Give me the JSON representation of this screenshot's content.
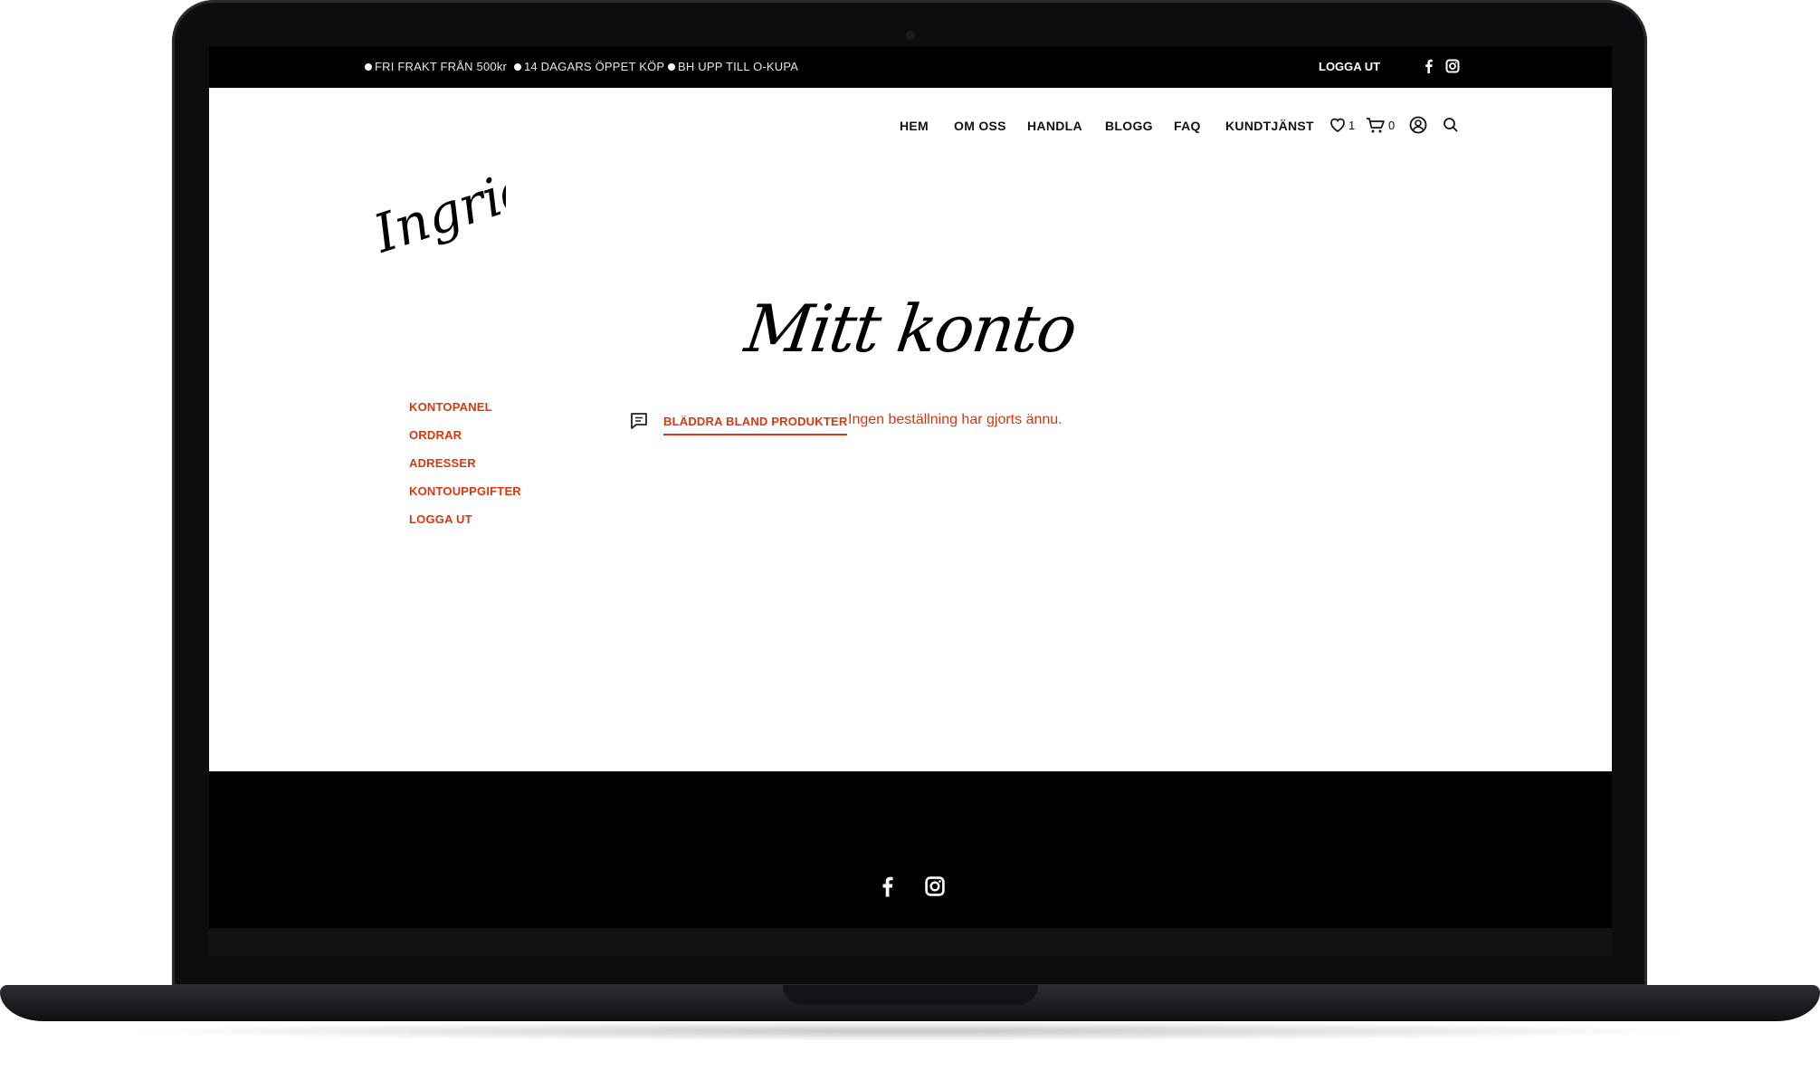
{
  "topbar": {
    "promos": [
      "FRI FRAKT FRÅN 500kr",
      "14 DAGARS ÖPPET KÖP",
      "BH UPP TILL O-KUPA"
    ],
    "logout_label": "LOGGA UT",
    "social_icons": [
      "facebook-icon",
      "instagram-icon"
    ]
  },
  "header": {
    "logo_text": "Ingrids",
    "nav": [
      "HEM",
      "OM OSS",
      "HANDLA",
      "BLOGG",
      "FAQ",
      "KUNDTJÄNST"
    ],
    "wishlist_count": "1",
    "cart_count": "0",
    "icons": [
      "heart-icon",
      "cart-icon",
      "user-icon",
      "search-icon"
    ]
  },
  "page": {
    "title": "Mitt konto"
  },
  "account_nav": [
    "KONTOPANEL",
    "ORDRAR",
    "ADRESSER",
    "KONTOUPPGIFTER",
    "LOGGA UT"
  ],
  "notice": {
    "button_label": "BLÄDDRA BLAND PRODUKTER",
    "message": "Ingen beställning har gjorts ännu.",
    "icon": "message-icon"
  },
  "footer": {
    "social_icons": [
      "facebook-icon",
      "instagram-icon"
    ]
  },
  "colors": {
    "accent": "#d9380f",
    "topbar_bg": "#000000",
    "text": "#111111"
  }
}
